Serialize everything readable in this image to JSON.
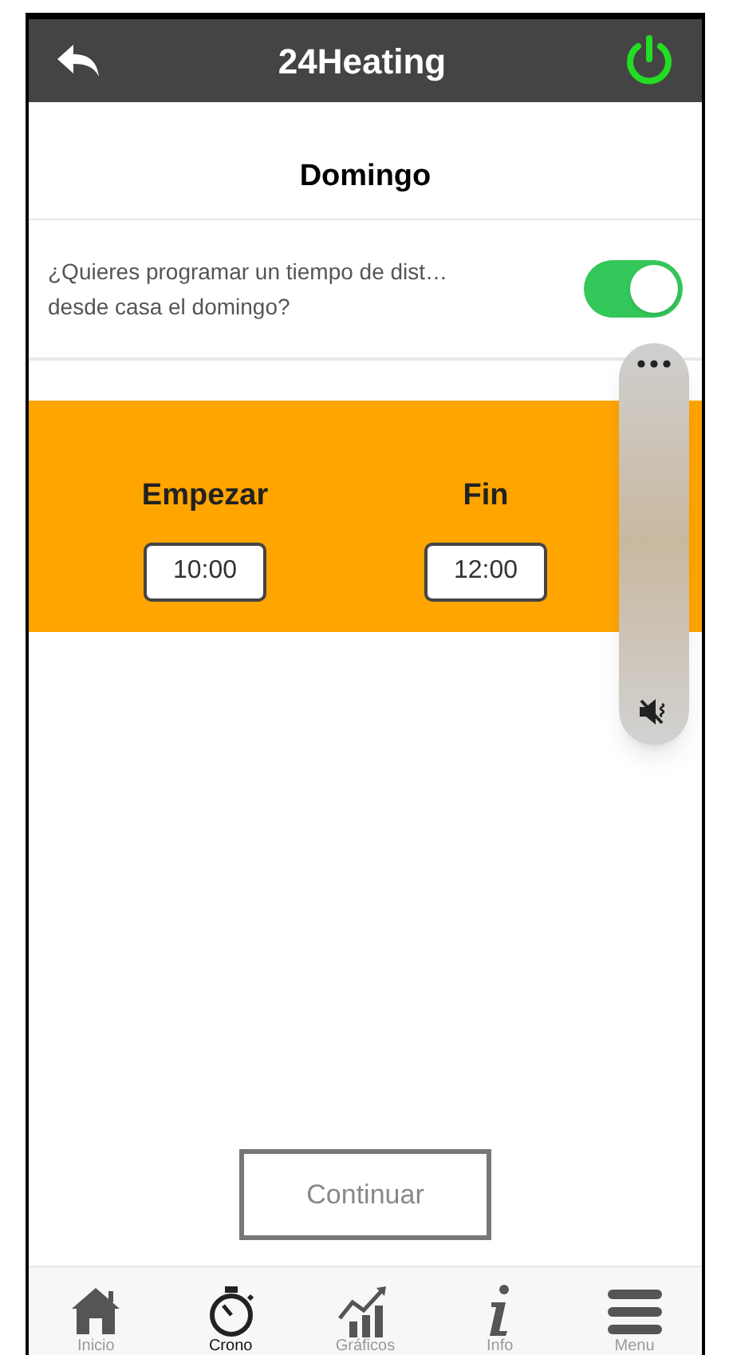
{
  "header": {
    "title": "24Heating",
    "power_on": true
  },
  "day_title": "Domingo",
  "question": {
    "text": "¿Quieres programar un tiempo de dist…\ndesde casa el domingo?",
    "on": true
  },
  "schedule": {
    "start_label": "Empezar",
    "start_value": "10:00",
    "end_label": "Fin",
    "end_value": "12:00"
  },
  "volume_overlay": {
    "muted": true
  },
  "continue_button": "Continuar",
  "tabs": [
    {
      "label": "Inicio",
      "kind": "home",
      "selected": false
    },
    {
      "label": "Crono",
      "kind": "timer",
      "selected": true
    },
    {
      "label": "Gráficos",
      "kind": "chart",
      "selected": false
    },
    {
      "label": "Info",
      "kind": "info",
      "selected": false
    },
    {
      "label": "Menu",
      "kind": "menu",
      "selected": false
    }
  ]
}
